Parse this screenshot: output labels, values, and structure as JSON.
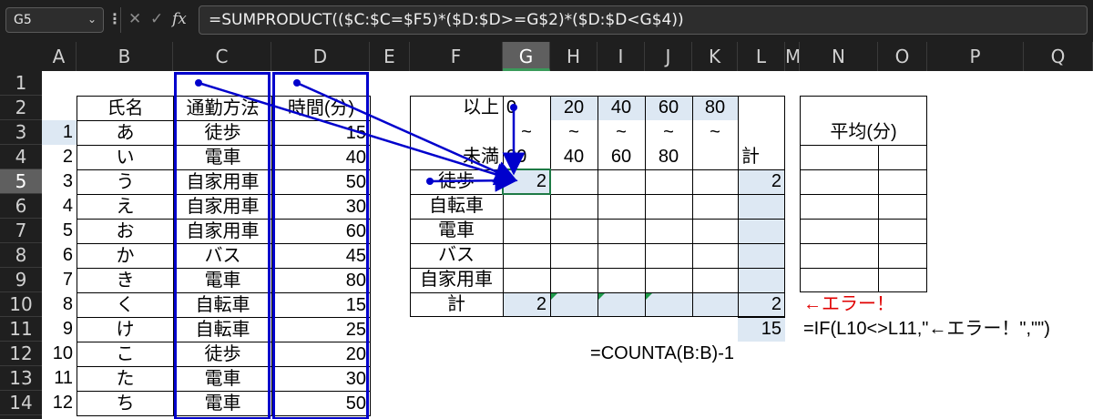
{
  "formula_bar": {
    "name_box": "G5",
    "formula": "=SUMPRODUCT(($C:$C=$F5)*($D:$D>=G$2)*($D:$D<G$4))",
    "cancel_glyph": "✕",
    "enter_glyph": "✓",
    "fx_glyph": "fx"
  },
  "columns": [
    "A",
    "B",
    "C",
    "D",
    "E",
    "F",
    "G",
    "H",
    "I",
    "J",
    "K",
    "L",
    "M",
    "N",
    "O",
    "P",
    "Q"
  ],
  "selected_column": "G",
  "rows": [
    "1",
    "2",
    "3",
    "4",
    "5",
    "6",
    "7",
    "8",
    "9",
    "10",
    "11",
    "12",
    "13",
    "14"
  ],
  "selected_row": "5",
  "data_table": {
    "headers": [
      "氏名",
      "通勤方法",
      "時間(分)"
    ],
    "records": [
      {
        "no": "1",
        "name": "あ",
        "method": "徒歩",
        "time": "15"
      },
      {
        "no": "2",
        "name": "い",
        "method": "電車",
        "time": "40"
      },
      {
        "no": "3",
        "name": "う",
        "method": "自家用車",
        "time": "50"
      },
      {
        "no": "4",
        "name": "え",
        "method": "自家用車",
        "time": "30"
      },
      {
        "no": "5",
        "name": "お",
        "method": "自家用車",
        "time": "60"
      },
      {
        "no": "6",
        "name": "か",
        "method": "バス",
        "time": "45"
      },
      {
        "no": "7",
        "name": "き",
        "method": "電車",
        "time": "80"
      },
      {
        "no": "8",
        "name": "く",
        "method": "自転車",
        "time": "15"
      },
      {
        "no": "9",
        "name": "け",
        "method": "自転車",
        "time": "25"
      },
      {
        "no": "10",
        "name": "こ",
        "method": "徒歩",
        "time": "20"
      },
      {
        "no": "11",
        "name": "た",
        "method": "電車",
        "time": "30"
      },
      {
        "no": "12",
        "name": "ち",
        "method": "電車",
        "time": "50"
      }
    ]
  },
  "cross_table": {
    "lower_label": "以上",
    "upper_label": "未満",
    "lower_bounds": [
      "0",
      "20",
      "40",
      "60",
      "80"
    ],
    "tilde": "~",
    "upper_bounds": [
      "20",
      "40",
      "60",
      "80",
      ""
    ],
    "total_label": "計",
    "methods": [
      "徒歩",
      "自転車",
      "電車",
      "バス",
      "自家用車"
    ],
    "g5_value": "2",
    "l5_value": "2",
    "g10_value": "2",
    "l10_value": "2",
    "l11_value": "15"
  },
  "average_table": {
    "header": "平均(分)"
  },
  "annotations": {
    "error_text": "←エラー！",
    "if_formula": "=IF(L10<>L11,\"←エラー！\",\"\")",
    "counta_formula": "=COUNTA(B:B)-1"
  },
  "colors": {
    "dark_ui": "#1f1f1f",
    "blue_fill": "#dde8f3",
    "arrow_blue": "#0000cc",
    "error_red": "#e00000",
    "selection_green": "#1e7a45"
  }
}
